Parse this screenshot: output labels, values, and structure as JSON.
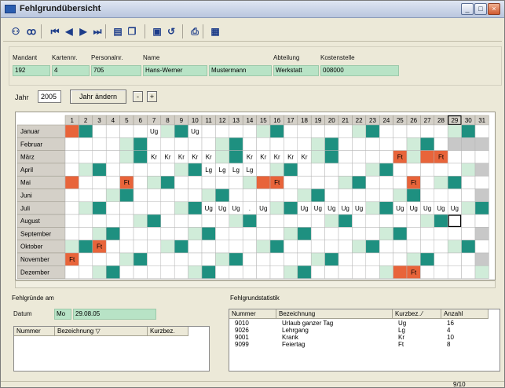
{
  "window": {
    "title": "Fehlgrundübersicht"
  },
  "toolbar": {
    "items": [
      {
        "name": "users-icon",
        "glyph": "⚇"
      },
      {
        "name": "glasses-icon",
        "glyph": "ꝏ"
      },
      {
        "name": "first-record-icon",
        "glyph": "⏮"
      },
      {
        "name": "prev-record-icon",
        "glyph": "◀"
      },
      {
        "name": "next-record-icon",
        "glyph": "▶"
      },
      {
        "name": "last-record-icon",
        "glyph": "⏭"
      },
      {
        "name": "new-record-icon",
        "glyph": "▤"
      },
      {
        "name": "copy-record-icon",
        "glyph": "❐"
      },
      {
        "name": "save-icon",
        "glyph": "▣"
      },
      {
        "name": "undo-icon",
        "glyph": "↺"
      },
      {
        "name": "print-icon",
        "glyph": "⎙"
      },
      {
        "name": "export-icon",
        "glyph": "▦"
      }
    ]
  },
  "person": {
    "mandant_label": "Mandant",
    "mandant": "192",
    "kartennr_label": "Kartennr.",
    "kartennr": "4",
    "personalnr_label": "Personalnr.",
    "personalnr": "705",
    "name_label": "Name",
    "vorname": "Hans-Werner",
    "nachname": "Mustermann",
    "abteilung_label": "Abteilung",
    "abteilung": "Werkstatt",
    "kostenstelle_label": "Kostenstelle",
    "kostenstelle": "008000"
  },
  "year": {
    "label": "Jahr",
    "value": "2005",
    "change_button": "Jahr ändern",
    "prev": "-",
    "next": "+"
  },
  "calendar": {
    "colors": {
      "weekend": "#d0ecd9",
      "sunday": "#1e9080",
      "absence": "#e8643a",
      "empty": "#ffffff",
      "header": "#d4d0c8",
      "inactive": "#c8c8c8"
    },
    "months": [
      "Januar",
      "Februar",
      "März",
      "April",
      "Mai",
      "Juni",
      "Juli",
      "August",
      "September",
      "Oktober",
      "November",
      "Dezember"
    ],
    "days": [
      "1",
      "2",
      "3",
      "4",
      "5",
      "6",
      "7",
      "8",
      "9",
      "10",
      "11",
      "12",
      "13",
      "14",
      "15",
      "16",
      "17",
      "18",
      "19",
      "20",
      "21",
      "22",
      "23",
      "24",
      "25",
      "26",
      "27",
      "28",
      "29",
      "30",
      "31"
    ],
    "selected_day": 29,
    "selected_month": 7,
    "entries": [
      {
        "m": 0,
        "d": 7,
        "code": "Ug"
      },
      {
        "m": 0,
        "d": 10,
        "code": "Ug"
      },
      {
        "m": 0,
        "d": 1,
        "code": "",
        "ft": true
      },
      {
        "m": 2,
        "d": 7,
        "code": "Kr"
      },
      {
        "m": 2,
        "d": 8,
        "code": "Kr"
      },
      {
        "m": 2,
        "d": 9,
        "code": "Kr"
      },
      {
        "m": 2,
        "d": 10,
        "code": "Kr"
      },
      {
        "m": 2,
        "d": 11,
        "code": "Kr"
      },
      {
        "m": 2,
        "d": 14,
        "code": "Kr"
      },
      {
        "m": 2,
        "d": 15,
        "code": "Kr"
      },
      {
        "m": 2,
        "d": 16,
        "code": "Kr"
      },
      {
        "m": 2,
        "d": 17,
        "code": "Kr"
      },
      {
        "m": 2,
        "d": 18,
        "code": "Kr"
      },
      {
        "m": 2,
        "d": 25,
        "code": "Ft",
        "ft": true
      },
      {
        "m": 2,
        "d": 27,
        "code": "",
        "ft": true
      },
      {
        "m": 2,
        "d": 28,
        "code": "Ft",
        "ft": true
      },
      {
        "m": 3,
        "d": 11,
        "code": "Lg"
      },
      {
        "m": 3,
        "d": 12,
        "code": "Lg"
      },
      {
        "m": 3,
        "d": 13,
        "code": "Lg"
      },
      {
        "m": 3,
        "d": 14,
        "code": "Lg"
      },
      {
        "m": 4,
        "d": 1,
        "code": "",
        "ft": true
      },
      {
        "m": 4,
        "d": 5,
        "code": "Ft",
        "ft": true
      },
      {
        "m": 4,
        "d": 15,
        "code": "",
        "ft": true
      },
      {
        "m": 4,
        "d": 16,
        "code": "Ft",
        "ft": true
      },
      {
        "m": 4,
        "d": 26,
        "code": "Ft",
        "ft": true
      },
      {
        "m": 6,
        "d": 11,
        "code": "Ug"
      },
      {
        "m": 6,
        "d": 12,
        "code": "Ug"
      },
      {
        "m": 6,
        "d": 13,
        "code": "Ug"
      },
      {
        "m": 6,
        "d": 14,
        "code": "."
      },
      {
        "m": 6,
        "d": 15,
        "code": "Ug"
      },
      {
        "m": 6,
        "d": 18,
        "code": "Ug"
      },
      {
        "m": 6,
        "d": 19,
        "code": "Ug"
      },
      {
        "m": 6,
        "d": 20,
        "code": "Ug"
      },
      {
        "m": 6,
        "d": 21,
        "code": "Ug"
      },
      {
        "m": 6,
        "d": 22,
        "code": "Ug"
      },
      {
        "m": 6,
        "d": 25,
        "code": "Ug"
      },
      {
        "m": 6,
        "d": 26,
        "code": "Ug"
      },
      {
        "m": 6,
        "d": 27,
        "code": "Ug"
      },
      {
        "m": 6,
        "d": 28,
        "code": "Ug"
      },
      {
        "m": 6,
        "d": 29,
        "code": "Ug"
      },
      {
        "m": 9,
        "d": 3,
        "code": "Ft",
        "ft": true
      },
      {
        "m": 10,
        "d": 1,
        "code": "Ft",
        "ft": true
      },
      {
        "m": 11,
        "d": 25,
        "code": "",
        "ft": true
      },
      {
        "m": 11,
        "d": 26,
        "code": "Ft",
        "ft": true
      }
    ]
  },
  "fehlgruende": {
    "title": "Fehlgründe am",
    "datum_label": "Datum",
    "weekday": "Mo",
    "date": "29.08.05",
    "columns": [
      "Nummer",
      "Bezeichnung ▽",
      "Kurzbez."
    ]
  },
  "statistik": {
    "title": "Fehlgrundstatistik",
    "columns": [
      "Nummer",
      "Bezeichnung",
      "Kurzbez. ⁄",
      "Anzahl"
    ],
    "rows": [
      [
        "9010",
        "Urlaub ganzer Tag",
        "Ug",
        "16"
      ],
      [
        "9026",
        "Lehrgang",
        "Lg",
        "4"
      ],
      [
        "9001",
        "Krank",
        "Kr",
        "10"
      ],
      [
        "9099",
        "Feiertag",
        "Ft",
        "8"
      ]
    ]
  },
  "status": {
    "page": "9/10"
  }
}
